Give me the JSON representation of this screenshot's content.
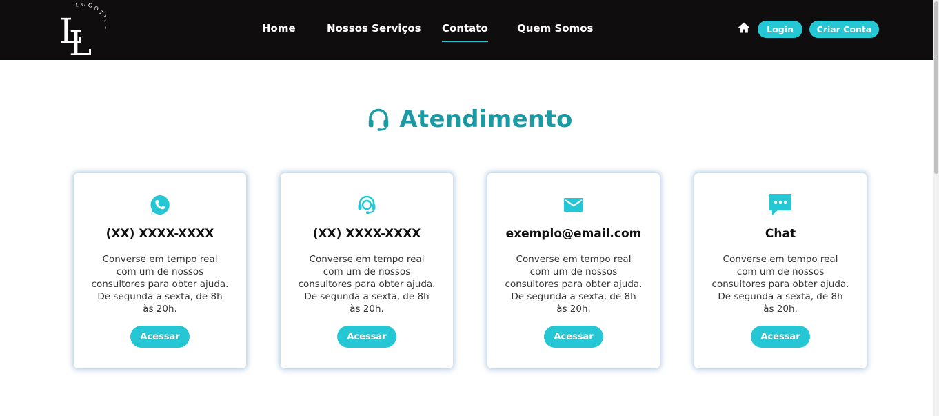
{
  "header": {
    "logo_text": "LOGOTIPO",
    "nav": [
      {
        "label": "Home",
        "active": false
      },
      {
        "label": "Nossos Serviços",
        "active": false
      },
      {
        "label": "Contato",
        "active": true
      },
      {
        "label": "Quem Somos",
        "active": false
      }
    ],
    "home_icon": "home-icon",
    "login_label": "Login",
    "signup_label": "Criar Conta"
  },
  "section": {
    "title": "Atendimento",
    "icon": "headset-icon"
  },
  "cards": [
    {
      "icon": "whatsapp-icon",
      "title": "(XX) XXXX-XXXX",
      "description": "Converse em tempo real com um de nossos consultores para obter ajuda. De segunda a sexta, de 8h às 20h.",
      "button": "Acessar"
    },
    {
      "icon": "support-agent-icon",
      "title": "(XX) XXXX-XXXX",
      "description": "Converse em tempo real com um de nossos consultores para obter ajuda. De segunda a sexta, de 8h às 20h.",
      "button": "Acessar"
    },
    {
      "icon": "email-icon",
      "title": "exemplo@email.com",
      "description": "Converse em tempo real com um de nossos consultores para obter ajuda. De segunda a sexta, de 8h às 20h.",
      "button": "Acessar"
    },
    {
      "icon": "chat-icon",
      "title": "Chat",
      "description": "Converse em tempo real com um de nossos consultores para obter ajuda. De segunda a sexta, de 8h às 20h.",
      "button": "Acessar"
    }
  ],
  "colors": {
    "header_bg": "#0f0d0d",
    "accent": "#24c7d3",
    "heading": "#1b9aa3"
  }
}
